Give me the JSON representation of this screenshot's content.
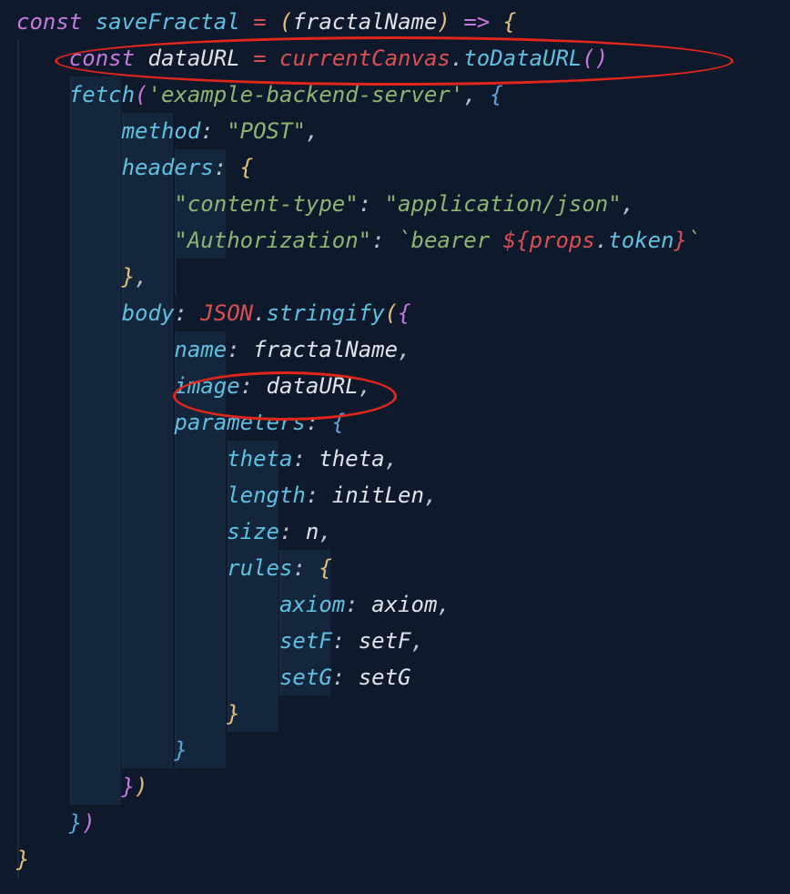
{
  "code": {
    "l1": {
      "const": "const",
      "fn": "saveFractal",
      "eq": "=",
      "open": "(",
      "param": "fractalName",
      "close": ")",
      "arrow": "=>",
      "brace": "{"
    },
    "l2": {
      "const": "const",
      "name": "dataURL",
      "eq": "=",
      "obj": "currentCanvas",
      "dot": ".",
      "method": "toDataURL",
      "parens": "()"
    },
    "l3": {
      "fn": "fetch",
      "open": "(",
      "str": "'example-backend-server'",
      "comma": ",",
      "brace": "{"
    },
    "l4": {
      "key": "method",
      "colon": ":",
      "val": "\"POST\"",
      "comma": ","
    },
    "l5": {
      "key": "headers",
      "colon": ":",
      "brace": "{"
    },
    "l6": {
      "key": "\"content-type\"",
      "colon": ":",
      "val": "\"application/json\"",
      "comma": ","
    },
    "l7": {
      "key": "\"Authorization\"",
      "colon": ":",
      "bt": "`",
      "bearer": "bearer ",
      "dli": "${",
      "obj": "props",
      "dot": ".",
      "prop": "token",
      "dlr": "}",
      "bt2": "`"
    },
    "l8": {
      "close": "}",
      "comma": ","
    },
    "l9": {
      "key": "body",
      "colon": ":",
      "obj": "JSON",
      "dot": ".",
      "fn": "stringify",
      "open": "(",
      "brace": "{"
    },
    "l10": {
      "key": "name",
      "colon": ":",
      "val": "fractalName",
      "comma": ","
    },
    "l11": {
      "key": "image",
      "colon": ":",
      "val": "dataURL",
      "comma": ","
    },
    "l12": {
      "key": "parameters",
      "colon": ":",
      "brace": "{"
    },
    "l13": {
      "key": "theta",
      "colon": ":",
      "val": "theta",
      "comma": ","
    },
    "l14": {
      "key": "length",
      "colon": ":",
      "val": "initLen",
      "comma": ","
    },
    "l15": {
      "key": "size",
      "colon": ":",
      "val": "n",
      "comma": ","
    },
    "l16": {
      "key": "rules",
      "colon": ":",
      "brace": "{"
    },
    "l17": {
      "key": "axiom",
      "colon": ":",
      "val": "axiom",
      "comma": ","
    },
    "l18": {
      "key": "setF",
      "colon": ":",
      "val": "setF",
      "comma": ","
    },
    "l19": {
      "key": "setG",
      "colon": ":",
      "val": "setG"
    },
    "l20": {
      "close": "}"
    },
    "l21": {
      "close": "}"
    },
    "l22": {
      "closeB": "}",
      "closeP": ")"
    },
    "l23": {
      "closeB": "}",
      "closeP": ")"
    },
    "l24": {
      "close": "}"
    }
  },
  "annotations": {
    "ellipse1": "highlight-dataURL-declaration",
    "ellipse2": "highlight-image-dataURL-usage"
  },
  "colors": {
    "background": "#0e1a2b",
    "keyword": "#c678dd",
    "function": "#5fc0e0",
    "variable": "#d94f54",
    "string": "#8fb573",
    "brace_yellow": "#e5c07b",
    "brace_violet": "#c678dd",
    "brace_blue": "#5fa6d8",
    "annotation_red": "#e1261c"
  }
}
